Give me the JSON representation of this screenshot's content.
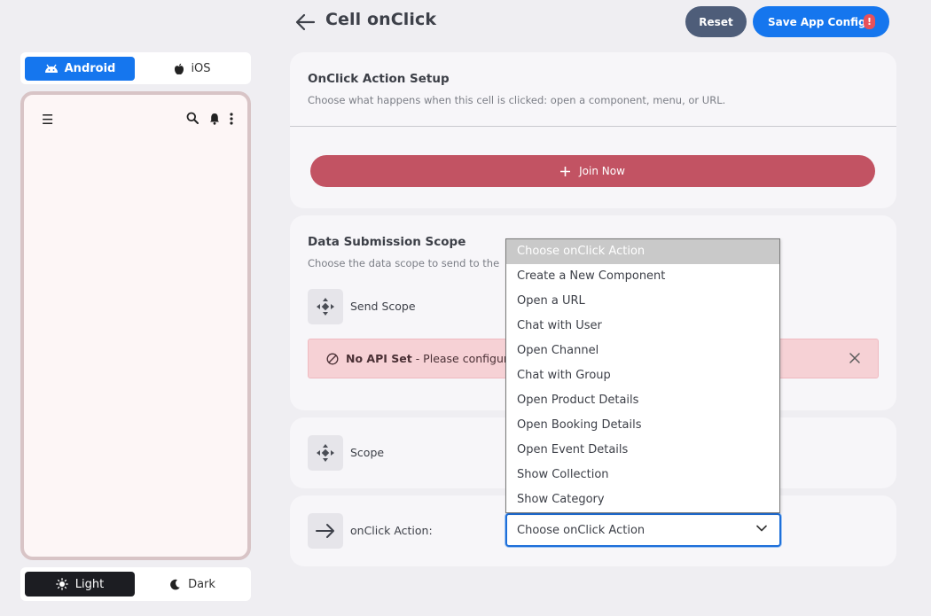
{
  "header": {
    "title": "Cell onClick",
    "reset_label": "Reset",
    "save_label": "Save App Config",
    "save_alert": "!"
  },
  "platform": {
    "android_label": "Android",
    "ios_label": "iOS",
    "selected": "Android"
  },
  "theme": {
    "light_label": "Light",
    "dark_label": "Dark",
    "selected": "Light"
  },
  "onclick_setup": {
    "title": "OnClick Action Setup",
    "description": "Choose what happens when this cell is clicked: open a component, menu, or URL.",
    "button_label": "Join Now"
  },
  "data_submission": {
    "title": "Data Submission Scope",
    "description": "Choose the data scope to send to the",
    "send_scope_label": "Send Scope",
    "alert_bold": "No API Set",
    "alert_text": "- Please configure"
  },
  "scope": {
    "label": "Scope"
  },
  "onclick_action": {
    "label": "onClick Action:",
    "selected_value": "Choose onClick Action",
    "options": [
      "Choose onClick Action",
      "Create a New Component",
      "Open a URL",
      "Chat with User",
      "Open Channel",
      "Chat with Group",
      "Open Product Details",
      "Open Booking Details",
      "Open Event Details",
      "Show Collection",
      "Show Category"
    ]
  },
  "colors": {
    "primary": "#1576ee",
    "reset": "#4e5d79",
    "join": "#c25363",
    "alert_bg": "#f6d1d5",
    "phone_border": "#d8c4c6"
  }
}
